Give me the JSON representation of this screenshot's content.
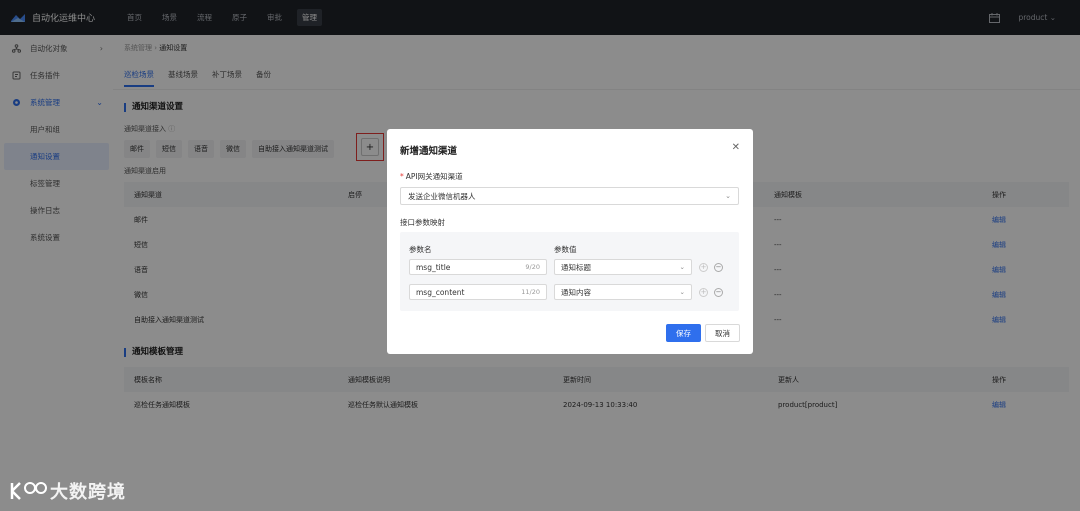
{
  "topbar": {
    "app_title": "自动化运维中心",
    "nav": [
      "首页",
      "场景",
      "流程",
      "原子",
      "审批",
      "管理"
    ],
    "active_nav": "管理",
    "user": "product"
  },
  "sidebar": {
    "items": [
      {
        "label": "自动化对象",
        "icon": "cluster-icon"
      },
      {
        "label": "任务插件",
        "icon": "plugin-icon"
      },
      {
        "label": "系统管理",
        "icon": "gear-icon"
      }
    ],
    "sub_items": [
      "用户和组",
      "通知设置",
      "标签管理",
      "操作日志",
      "系统设置"
    ],
    "active_sub": "通知设置"
  },
  "breadcrumb": {
    "parent": "系统管理",
    "current": "通知设置"
  },
  "tabs": [
    "巡检场景",
    "基线场景",
    "补丁场景",
    "备份"
  ],
  "channel_section": {
    "title": "通知渠道设置",
    "access_label": "通知渠道接入",
    "chips": [
      "邮件",
      "短信",
      "语音",
      "微信",
      "自助接入通知渠道测试"
    ],
    "plus_label": "+",
    "enable_label": "通知渠道启用",
    "columns": [
      "通知渠道",
      "启停",
      "通知模板",
      "操作"
    ],
    "rows": [
      {
        "name": "邮件",
        "on": false,
        "template": "---",
        "op": "编辑"
      },
      {
        "name": "短信",
        "on": true,
        "template": "---",
        "op": "编辑"
      },
      {
        "name": "语音",
        "on": false,
        "template": "---",
        "op": "编辑"
      },
      {
        "name": "微信",
        "on": false,
        "template": "---",
        "op": "编辑"
      },
      {
        "name": "自助接入通知渠道测试",
        "on": false,
        "template": "---",
        "op": "编辑"
      }
    ]
  },
  "template_section": {
    "title": "通知模板管理",
    "columns": [
      "模板名称",
      "通知模板说明",
      "更新时间",
      "更新人",
      "操作"
    ],
    "rows": [
      {
        "name": "巡检任务通知模板",
        "desc": "巡检任务默认通知模板",
        "time": "2024-09-13 10:33:40",
        "user": "product[product]",
        "op": "编辑"
      }
    ]
  },
  "modal": {
    "title": "新增通知渠道",
    "channel_label": "API网关通知渠道",
    "channel_value": "发送企业微信机器人",
    "mapping_label": "接口参数映射",
    "param_name_header": "参数名",
    "param_value_header": "参数值",
    "params": [
      {
        "name": "msg_title",
        "count": "9/20",
        "value": "通知标题"
      },
      {
        "name": "msg_content",
        "count": "11/20",
        "value": "通知内容"
      }
    ],
    "save": "保存",
    "cancel": "取消"
  },
  "watermark": {
    "text": "大数跨境"
  }
}
